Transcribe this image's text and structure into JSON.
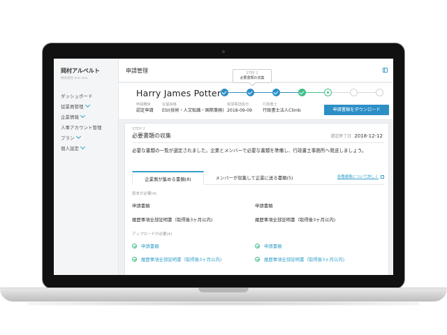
{
  "sidebar": {
    "company": "岡村アルベルト",
    "company_sub": "株式会社 one visa",
    "items": [
      {
        "label": "ダッシュボード"
      },
      {
        "label": "従業員管理"
      },
      {
        "label": "企業情報"
      },
      {
        "label": "人事アカウント管理"
      },
      {
        "label": "プラン"
      },
      {
        "label": "個人設定"
      }
    ]
  },
  "header": {
    "title": "申請管理",
    "tooltip_step": "STEP 2",
    "tooltip_label": "必要書類の収集"
  },
  "profile": {
    "name": "Harry James Potter",
    "meta": [
      {
        "label": "申請種目",
        "value": "認定申請"
      },
      {
        "label": "在留資格",
        "value": "ESI(技術・人文知識・国際業務)"
      },
      {
        "label": "質問票送信日",
        "value": "2018-09-09"
      },
      {
        "label": "行政書士",
        "value": "行政書士法人Climb"
      }
    ],
    "download_button": "申請書類をダウンロード",
    "steps": [
      "done",
      "done",
      "done",
      "done-green",
      "current",
      "todo",
      "todo"
    ],
    "colors": {
      "primary": "#2e8fc7",
      "success": "#3fbf88"
    }
  },
  "card": {
    "step": "STEP 2",
    "title": "必要書類の収集",
    "deadline_label": "選定終了日",
    "deadline": "2018-12-12",
    "description": "必要な書類の一覧が選定されました。企業とメンバーで必要な書類を準備し、行政書士事務所へ発送しましょう。",
    "tabs": [
      {
        "label": "企業側が集める書類(8)"
      },
      {
        "label": "メンバーが収集して企業に送る書類(5)"
      }
    ],
    "tab_link": "各種書類について詳しく",
    "originals_header": "原本が必要(4)",
    "originals": [
      [
        "申請書類",
        "申請書類"
      ],
      [
        "履歴事項全部証明書（取得後3ヶ月以内)",
        "履歴事項全部証明書（取得後3ヶ月以内)"
      ]
    ],
    "upload_header": "アップロードが必要(4)",
    "uploads": [
      [
        "申請書類",
        "申請書類"
      ],
      [
        "履歴事項全部証明書（取得後3ヶ月以内)",
        "履歴事項全部証明書（取得後3ヶ月以内)"
      ]
    ]
  }
}
